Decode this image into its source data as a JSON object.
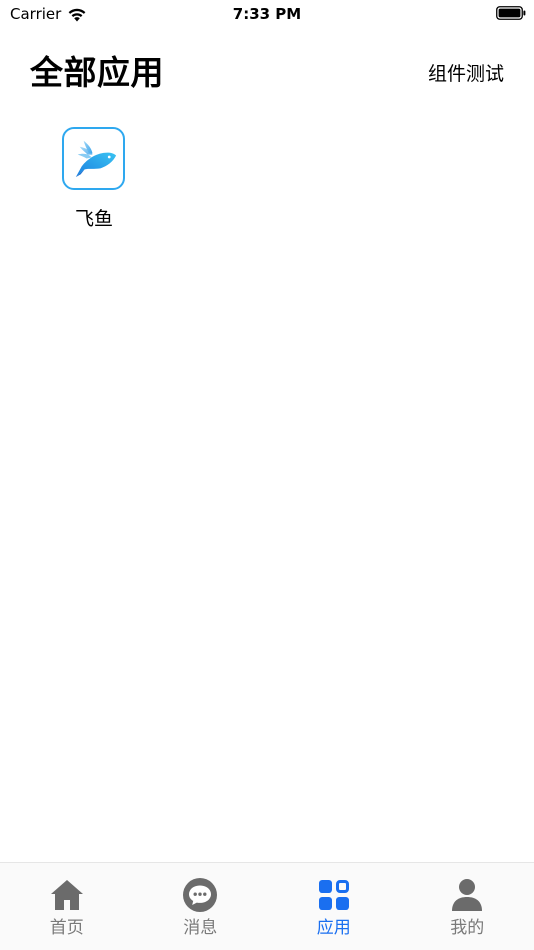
{
  "status_bar": {
    "carrier": "Carrier",
    "time": "7:33 PM",
    "wifi_icon": "wifi-icon",
    "battery_icon": "battery-icon"
  },
  "header": {
    "title": "全部应用",
    "action_label": "组件测试"
  },
  "apps": [
    {
      "label": "飞鱼",
      "icon": "flying-fish-app-icon"
    }
  ],
  "tab_bar": {
    "active_color": "#1a6ff0",
    "inactive_color": "#7a7a7a",
    "tabs": [
      {
        "label": "首页",
        "icon": "home-icon",
        "active": false
      },
      {
        "label": "消息",
        "icon": "chat-bubble-icon",
        "active": false
      },
      {
        "label": "应用",
        "icon": "apps-grid-icon",
        "active": true
      },
      {
        "label": "我的",
        "icon": "person-icon",
        "active": false
      }
    ]
  }
}
